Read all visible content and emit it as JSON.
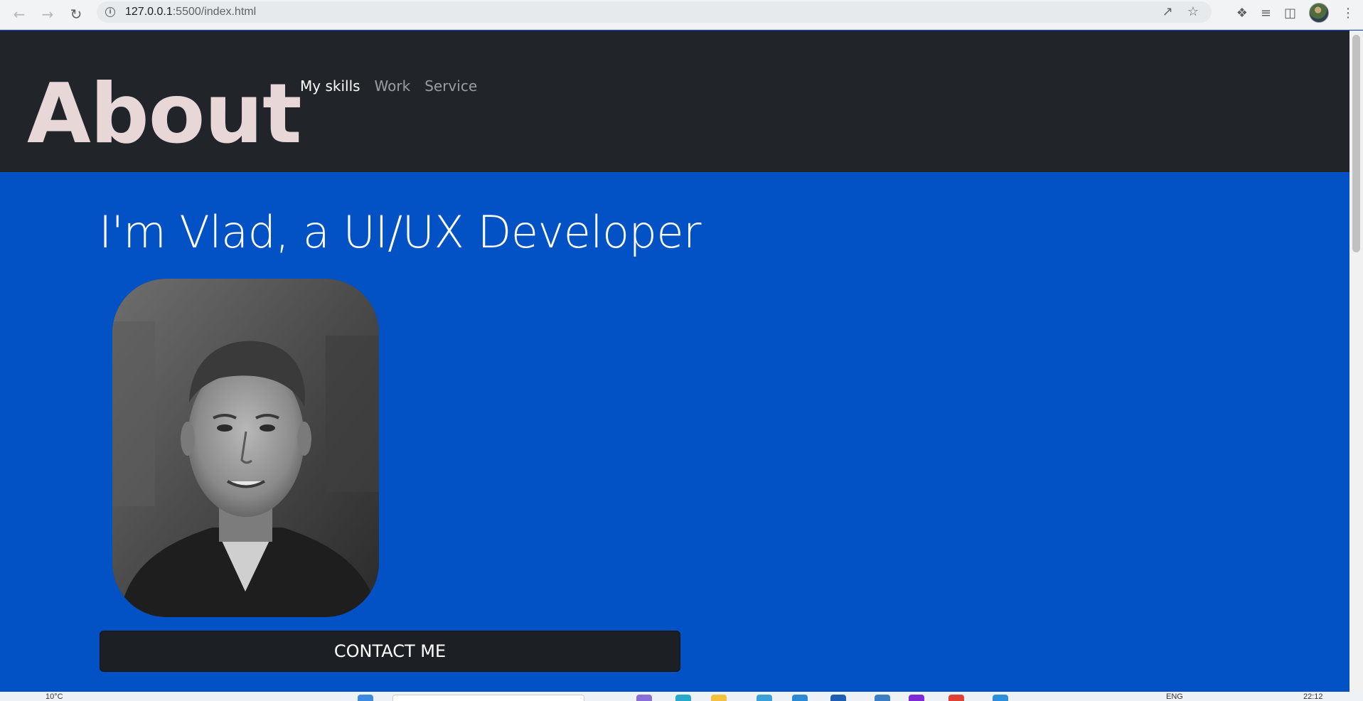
{
  "browser": {
    "url_host": "127.0.0.1",
    "url_path": ":5500/index.html",
    "info_icon_glyph": "i",
    "icons": [
      "back-arrow-icon",
      "forward-arrow-icon",
      "reload-icon",
      "info-icon",
      "share-icon",
      "bookmark-star-icon",
      "extensions-puzzle-icon",
      "reading-list-icon",
      "side-panel-icon",
      "profile-avatar",
      "more-vert-icon"
    ]
  },
  "header": {
    "brand": "About",
    "nav": [
      {
        "label": "My skills",
        "active": true
      },
      {
        "label": "Work",
        "active": false
      },
      {
        "label": "Service",
        "active": false
      }
    ]
  },
  "hero": {
    "title": "I'm Vlad, a UI/UX Developer",
    "photo": "grayscale portrait photo of a man",
    "contact_button": "CONTACT ME"
  },
  "taskbar": {
    "weather": "10°C",
    "language": "ENG",
    "time": "22:12"
  },
  "colors": {
    "header_bg": "#212529",
    "hero_bg": "#0251c5",
    "brand_color": "#e8d7d7",
    "button_bg": "#1c1f23"
  }
}
